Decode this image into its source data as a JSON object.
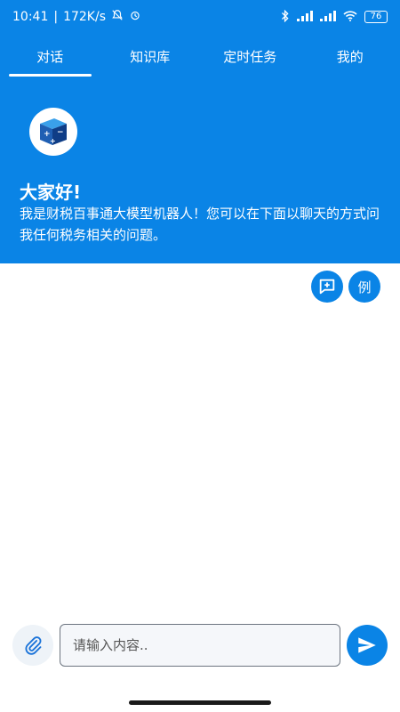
{
  "status": {
    "time": "10:41",
    "speed": "172K/s",
    "battery": "76"
  },
  "tabs": [
    {
      "label": "对话",
      "active": true
    },
    {
      "label": "知识库",
      "active": false
    },
    {
      "label": "定时任务",
      "active": false
    },
    {
      "label": "我的",
      "active": false
    }
  ],
  "hero": {
    "title": "大家好!",
    "text": "我是财税百事通大模型机器人！您可以在下面以聊天的方式问我任何税务相关的问题。"
  },
  "actions": {
    "example_label": "例"
  },
  "input": {
    "placeholder": "请输入内容.."
  },
  "colors": {
    "primary": "#0a84e6"
  }
}
